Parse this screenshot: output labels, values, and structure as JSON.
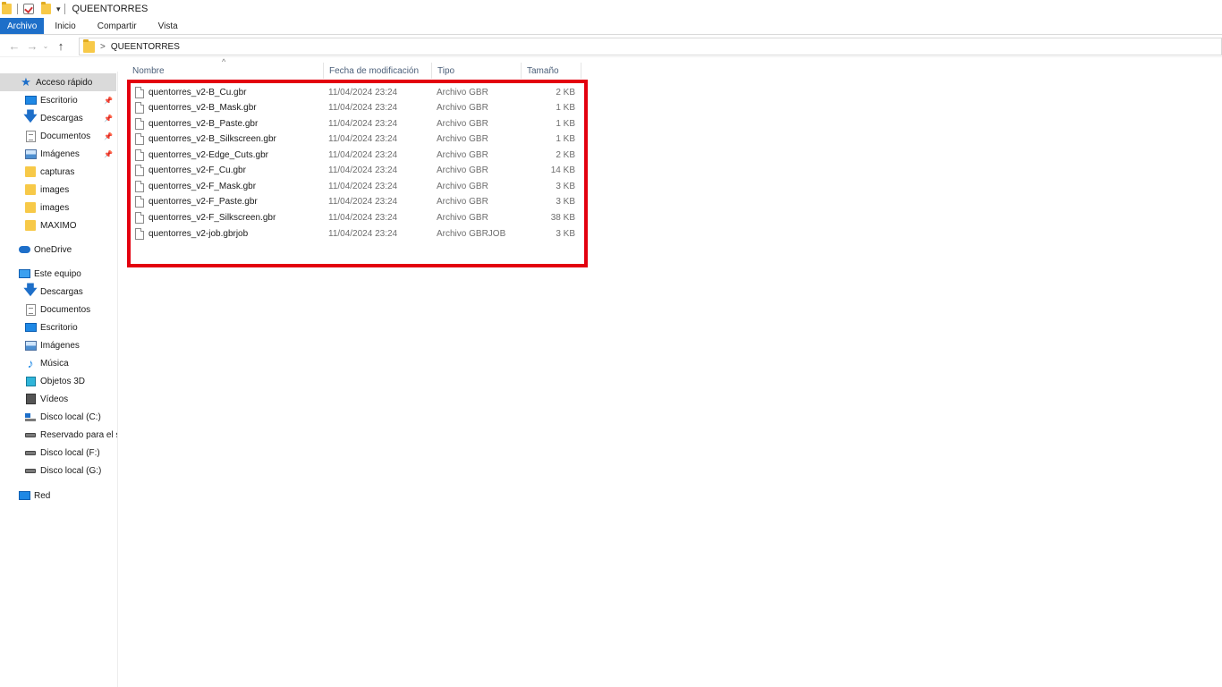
{
  "titlebar": {
    "title": "QUEENTORRES",
    "qat_dropdown": "▾"
  },
  "ribbon": {
    "tabs": [
      "Archivo",
      "Inicio",
      "Compartir",
      "Vista"
    ]
  },
  "address": {
    "back": "←",
    "forward": "→",
    "recent": "⌄",
    "up": "↑",
    "separator": ">",
    "path": "QUEENTORRES"
  },
  "nav": {
    "quick_access": "Acceso rápido",
    "pinned": [
      {
        "label": "Escritorio",
        "icon": "desktop-icon"
      },
      {
        "label": "Descargas",
        "icon": "download-icon"
      },
      {
        "label": "Documentos",
        "icon": "documents-icon"
      },
      {
        "label": "Imágenes",
        "icon": "pictures-icon"
      }
    ],
    "recent_folders": [
      "capturas",
      "images",
      "images",
      "MAXIMO"
    ],
    "onedrive": "OneDrive",
    "this_pc": "Este equipo",
    "pc_items": [
      {
        "label": "Descargas",
        "icon": "download-icon"
      },
      {
        "label": "Documentos",
        "icon": "documents-icon"
      },
      {
        "label": "Escritorio",
        "icon": "desktop-icon"
      },
      {
        "label": "Imágenes",
        "icon": "pictures-icon"
      },
      {
        "label": "Música",
        "icon": "music-icon"
      },
      {
        "label": "Objetos 3D",
        "icon": "objects-3d-icon"
      },
      {
        "label": "Vídeos",
        "icon": "videos-icon"
      },
      {
        "label": "Disco local (C:)",
        "icon": "drive-c-icon"
      },
      {
        "label": "Reservado para el si",
        "icon": "drive-icon"
      },
      {
        "label": "Disco local (F:)",
        "icon": "drive-icon"
      },
      {
        "label": "Disco local (G:)",
        "icon": "drive-icon"
      }
    ],
    "network": "Red"
  },
  "columns": {
    "sort_indicator": "^",
    "name": "Nombre",
    "modified": "Fecha de modificación",
    "type": "Tipo",
    "size": "Tamaño"
  },
  "files": [
    {
      "name": "quentorres_v2-B_Cu.gbr",
      "modified": "11/04/2024 23:24",
      "type": "Archivo GBR",
      "size": "2 KB"
    },
    {
      "name": "quentorres_v2-B_Mask.gbr",
      "modified": "11/04/2024 23:24",
      "type": "Archivo GBR",
      "size": "1 KB"
    },
    {
      "name": "quentorres_v2-B_Paste.gbr",
      "modified": "11/04/2024 23:24",
      "type": "Archivo GBR",
      "size": "1 KB"
    },
    {
      "name": "quentorres_v2-B_Silkscreen.gbr",
      "modified": "11/04/2024 23:24",
      "type": "Archivo GBR",
      "size": "1 KB"
    },
    {
      "name": "quentorres_v2-Edge_Cuts.gbr",
      "modified": "11/04/2024 23:24",
      "type": "Archivo GBR",
      "size": "2 KB"
    },
    {
      "name": "quentorres_v2-F_Cu.gbr",
      "modified": "11/04/2024 23:24",
      "type": "Archivo GBR",
      "size": "14 KB"
    },
    {
      "name": "quentorres_v2-F_Mask.gbr",
      "modified": "11/04/2024 23:24",
      "type": "Archivo GBR",
      "size": "3 KB"
    },
    {
      "name": "quentorres_v2-F_Paste.gbr",
      "modified": "11/04/2024 23:24",
      "type": "Archivo GBR",
      "size": "3 KB"
    },
    {
      "name": "quentorres_v2-F_Silkscreen.gbr",
      "modified": "11/04/2024 23:24",
      "type": "Archivo GBR",
      "size": "38 KB"
    },
    {
      "name": "quentorres_v2-job.gbrjob",
      "modified": "11/04/2024 23:24",
      "type": "Archivo GBRJOB",
      "size": "3 KB"
    }
  ],
  "colors": {
    "accent": "#1e6fc9",
    "highlight_box": "#e3000f",
    "selected_nav": "#dadada"
  }
}
